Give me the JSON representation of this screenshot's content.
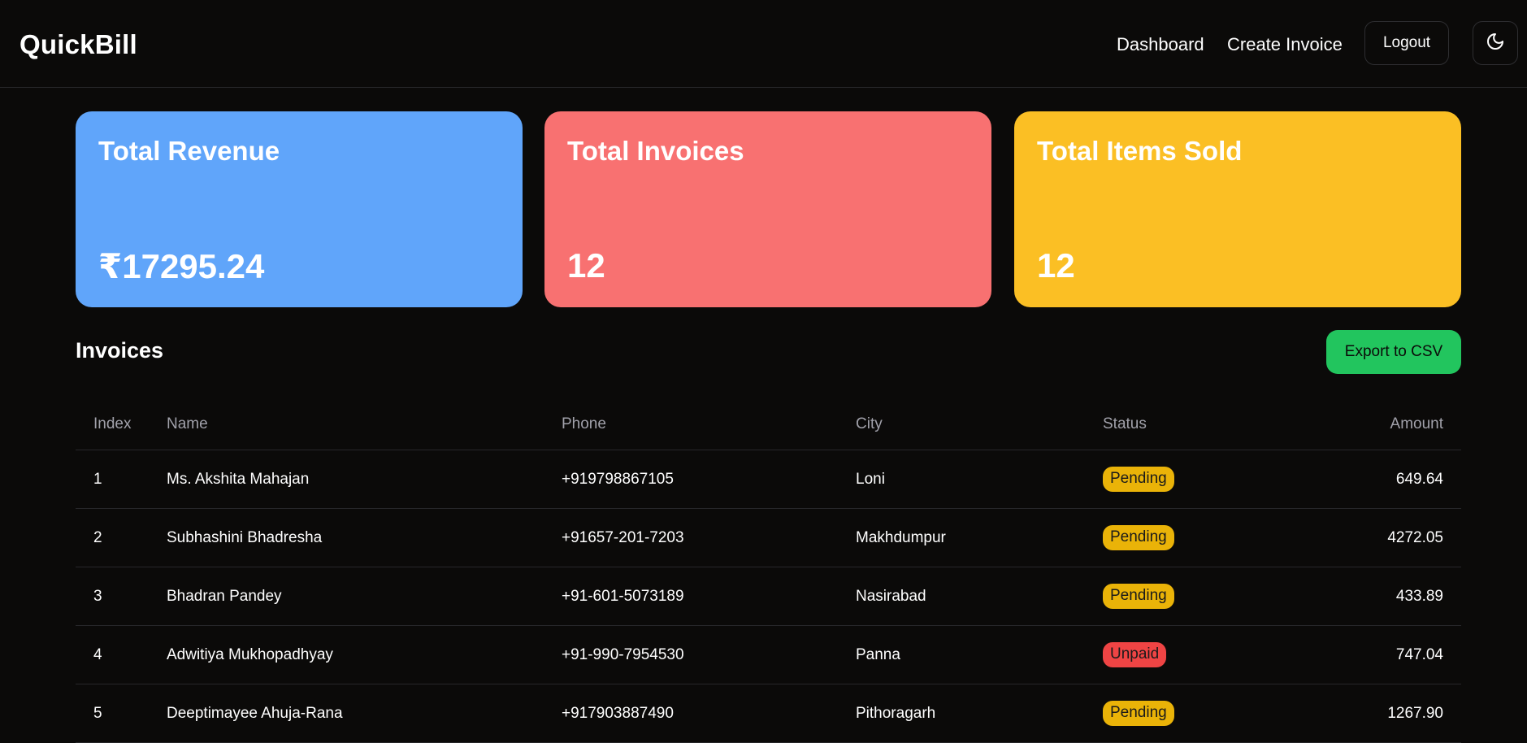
{
  "app": {
    "brand": "QuickBill"
  },
  "nav": {
    "dashboard": "Dashboard",
    "create_invoice": "Create Invoice",
    "logout": "Logout",
    "theme_icon": "moon-icon"
  },
  "cards": [
    {
      "title": "Total Revenue",
      "value": "₹17295.24",
      "color": "#60a5fa"
    },
    {
      "title": "Total Invoices",
      "value": "12",
      "color": "#f87171"
    },
    {
      "title": "Total Items Sold",
      "value": "12",
      "color": "#fbbf24"
    }
  ],
  "invoices": {
    "title": "Invoices",
    "export_label": "Export to CSV",
    "columns": {
      "index": "Index",
      "name": "Name",
      "phone": "Phone",
      "city": "City",
      "status": "Status",
      "amount": "Amount"
    },
    "rows": [
      {
        "index": "1",
        "name": "Ms. Akshita Mahajan",
        "phone": "+919798867105",
        "city": "Loni",
        "status": "Pending",
        "amount": "649.64"
      },
      {
        "index": "2",
        "name": "Subhashini Bhadresha",
        "phone": "+91657-201-7203",
        "city": "Makhdumpur",
        "status": "Pending",
        "amount": "4272.05"
      },
      {
        "index": "3",
        "name": "Bhadran Pandey",
        "phone": "+91-601-5073189",
        "city": "Nasirabad",
        "status": "Pending",
        "amount": "433.89"
      },
      {
        "index": "4",
        "name": "Adwitiya Mukhopadhyay",
        "phone": "+91-990-7954530",
        "city": "Panna",
        "status": "Unpaid",
        "amount": "747.04"
      },
      {
        "index": "5",
        "name": "Deeptimayee Ahuja-Rana",
        "phone": "+917903887490",
        "city": "Pithoragarh",
        "status": "Pending",
        "amount": "1267.90"
      }
    ]
  },
  "colors": {
    "background": "#0b0a09",
    "export_button": "#22c55e",
    "pending_badge": "#eab308",
    "unpaid_badge": "#ef4444"
  }
}
